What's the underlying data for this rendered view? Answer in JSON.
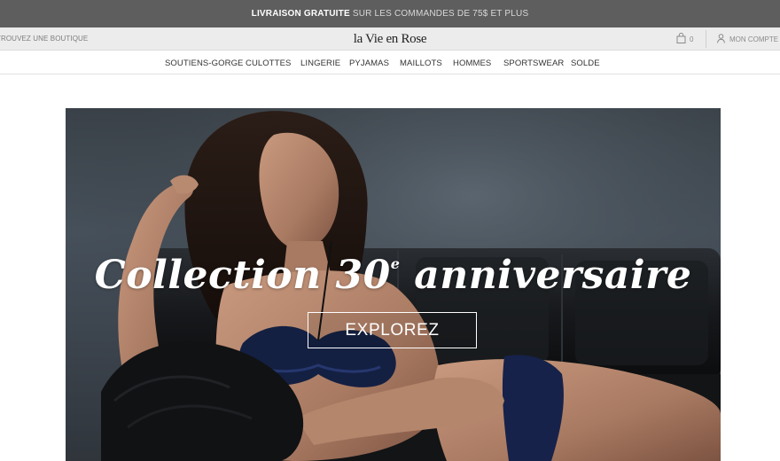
{
  "promo": {
    "strong": "LIVRAISON GRATUITE",
    "rest": "SUR LES COMMANDES DE 75$ ET PLUS"
  },
  "header": {
    "store_link": "TROUVEZ UNE BOUTIQUE",
    "logo": "la Vie en Rose",
    "cart_count": "0",
    "account_label": "MON COMPTE"
  },
  "nav": {
    "items": [
      "SOUTIENS-GORGE",
      "CULOTTES",
      "LINGERIE",
      "PYJAMAS",
      "MAILLOTS",
      "HOMMES",
      "SPORTSWEAR",
      "SOLDE"
    ]
  },
  "hero": {
    "title_main": "Collection 30",
    "title_sup": "e",
    "title_end": " anniversaire",
    "button_label": "EXPLOREZ"
  },
  "icons": {
    "cart": "shopping-bag-icon",
    "account": "user-icon"
  },
  "colors": {
    "promo_bg": "#5e5e5e",
    "utility_bg": "#ececec",
    "hero_bg": "#3e4650"
  }
}
